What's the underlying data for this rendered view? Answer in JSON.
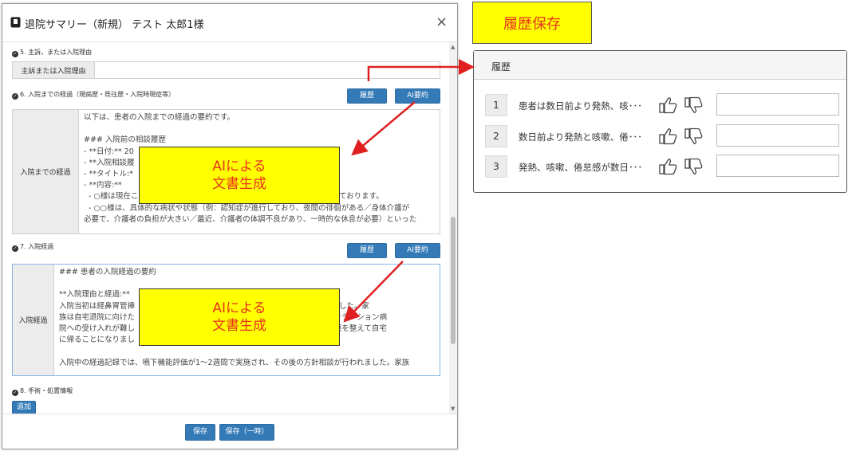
{
  "modal": {
    "title": "退院サマリー（新規） テスト 太郎1様",
    "close_label": "×"
  },
  "sections": {
    "s5": {
      "label": "5. 主訴，または入院理由",
      "field_label": "主訴または入院理由",
      "value": ""
    },
    "s6": {
      "label": "6. 入院までの経過（現病歴・既往歴・入院時現症等）",
      "field_label": "入院までの経過",
      "history_button": "履歴",
      "ai_button": "AI要約",
      "text": "以下は、患者の入院までの経過の要約です。\n\n### 入院前の相談履歴\n- **日付:** 20\n- **入院相談履\n- **タイトル:*\n- **内容:**\n  - ○様は現在こ                                                                          護されております。\n  - ○○様は、具体的な病状や状態（例：認知症が進行しており、夜間の徘徊がある／身体介護が\n必要で、介護者の負担が大きい／最近、介護者の体調不良があり、一時的な休息が必要）といった"
    },
    "s7": {
      "label": "7. 入院経過",
      "field_label": "入院経過",
      "history_button": "履歴",
      "ai_button": "AI要約",
      "text": "### 患者の入院経過の要約\n\n**入院理由と経過:**\n入院当初は経鼻胃管挿                                                                     下が困難でした。家\n族は自宅退院に向けた                                                                   からリハビリテーション病\n院への受け入れが難し                                                                   し、介護環境を整えて自宅\nに帰ることになりまし\n\n入院中の経過記録では、嚥下機能評価が1～2週間で実施され、その後の方針相談が行われました。家族"
    },
    "s8": {
      "label": "8. 手術・処置情報",
      "add_button": "追加"
    }
  },
  "overlay_text": {
    "line1": "AIによる",
    "line2": "文書生成"
  },
  "footer": {
    "save_button": "保存",
    "save_temp_button": "保存（一時）"
  },
  "annotation": {
    "history_save_label": "履歴保存"
  },
  "history_panel": {
    "title": "履歴",
    "rows": [
      {
        "num": "1",
        "text": "患者は数日前より発熱、咳･･･"
      },
      {
        "num": "2",
        "text": "数日前より発熱と咳嗽、倦･･･"
      },
      {
        "num": "3",
        "text": "発熱、咳嗽、倦怠感が数日･･･"
      }
    ]
  },
  "colors": {
    "primary_button": "#337ab7",
    "highlight_yellow": "#ffff00",
    "annotation_red": "#e8341c",
    "arrow_red": "#e02020"
  },
  "icons": {
    "thumb_up": "thumbs-up-icon",
    "thumb_down": "thumbs-down-icon",
    "document": "document-icon",
    "close": "close-icon"
  }
}
